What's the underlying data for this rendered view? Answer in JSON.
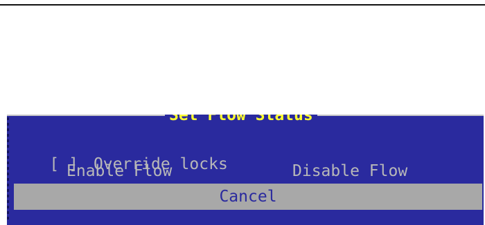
{
  "dialog": {
    "title": "Set Flow Status",
    "override": {
      "checkbox": "[ ]",
      "label": "Override locks"
    },
    "enable_flow_label": "Enable Flow",
    "disable_flow_label": "Disable Flow",
    "cancel_label": "Cancel"
  },
  "colors": {
    "dialog_background": "#2a2a9e",
    "title_text": "#ffff33",
    "body_text": "#b8b8b8",
    "selected_bar": "#a8a8a8"
  }
}
